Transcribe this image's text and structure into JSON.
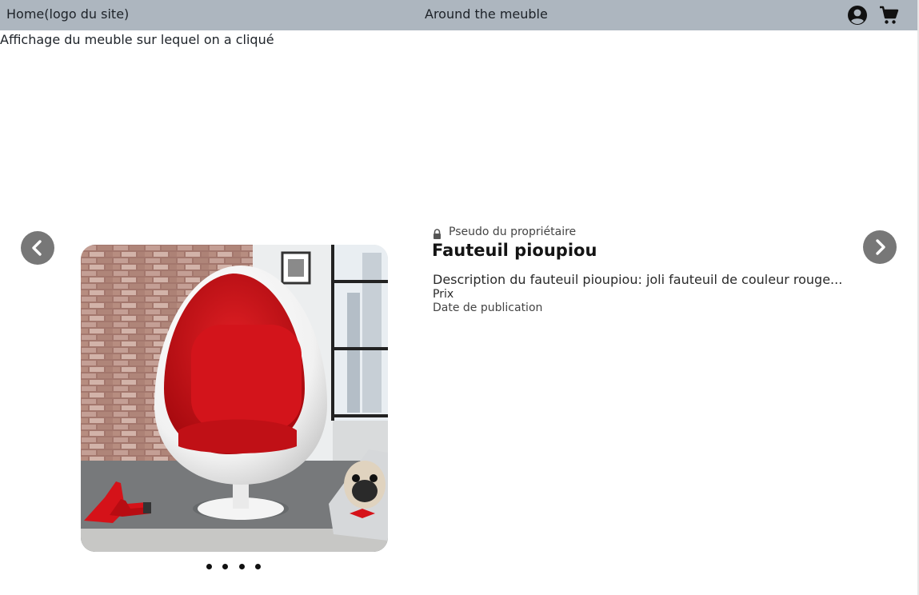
{
  "header": {
    "home_label": "Home(logo du site)",
    "site_title": "Around the meuble",
    "icons": [
      "user-circle-icon",
      "shopping-cart-icon"
    ],
    "background_color": "#adb6bf"
  },
  "page": {
    "subtitle": "Affichage du meuble sur lequel on a cliqué"
  },
  "product": {
    "owner_label": "Pseudo du propriétaire",
    "owner_icon": "lock-icon",
    "title": "Fauteuil pioupiou",
    "description": "Description du fauteuil pioupiou: joli fauteuil de couleur rouge...",
    "price_label": "Prix",
    "date_label": "Date de publication"
  },
  "carousel": {
    "prev_icon": "chevron-left-icon",
    "next_icon": "chevron-right-icon",
    "slide_count": 4,
    "arrow_color": "#777777"
  }
}
